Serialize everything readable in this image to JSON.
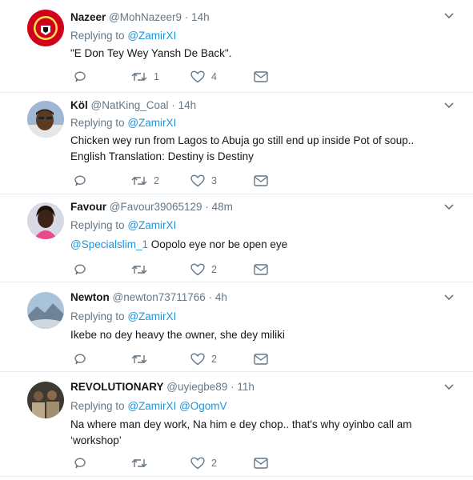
{
  "colors": {
    "link": "#1b95e0",
    "muted": "#657786",
    "text": "#14171a",
    "divider": "#e6ecf0"
  },
  "tweets": [
    {
      "name": "Nazeer",
      "handle": "@MohNazeer9",
      "time": "14h",
      "replying_label": "Replying to",
      "replying_to": [
        "@ZamirXI"
      ],
      "text_lines": [
        "\"E Don Tey Wey Yansh De Back\"."
      ],
      "retweets": "1",
      "likes": "4",
      "avatar_icon": "manchester-united-crest-avatar"
    },
    {
      "name": "Köl",
      "handle": "@NatKing_Coal",
      "time": "14h",
      "replying_label": "Replying to",
      "replying_to": [
        "@ZamirXI"
      ],
      "text_lines": [
        "Chicken wey run from Lagos to Abuja go still end up inside Pot of soup..",
        "English Translation: Destiny is Destiny"
      ],
      "retweets": "2",
      "likes": "3",
      "avatar_icon": "person-avatar"
    },
    {
      "name": "Favour",
      "handle": "@Favour39065129",
      "time": "48m",
      "replying_label": "Replying to",
      "replying_to": [
        "@ZamirXI"
      ],
      "mention_prefix": "@Specialslim_1",
      "text_lines": [
        " Oopolo eye nor be open eye"
      ],
      "retweets": "",
      "likes": "2",
      "avatar_icon": "person-avatar"
    },
    {
      "name": "Newton",
      "handle": "@newton73711766",
      "time": "4h",
      "replying_label": "Replying to",
      "replying_to": [
        "@ZamirXI"
      ],
      "text_lines": [
        "Ikebe no dey heavy the owner, she dey miliki"
      ],
      "retweets": "",
      "likes": "2",
      "avatar_icon": "landscape-avatar"
    },
    {
      "name": "REVOLUTIONARY",
      "handle": "@uyiegbe89",
      "time": "11h",
      "replying_label": "Replying to",
      "replying_to": [
        "@ZamirXI",
        "@OgomV"
      ],
      "text_lines": [
        "Na where man dey work, Na him e dey chop.. that's why oyinbo call am",
        "‘workshop’"
      ],
      "retweets": "",
      "likes": "2",
      "avatar_icon": "group-photo-avatar"
    }
  ]
}
